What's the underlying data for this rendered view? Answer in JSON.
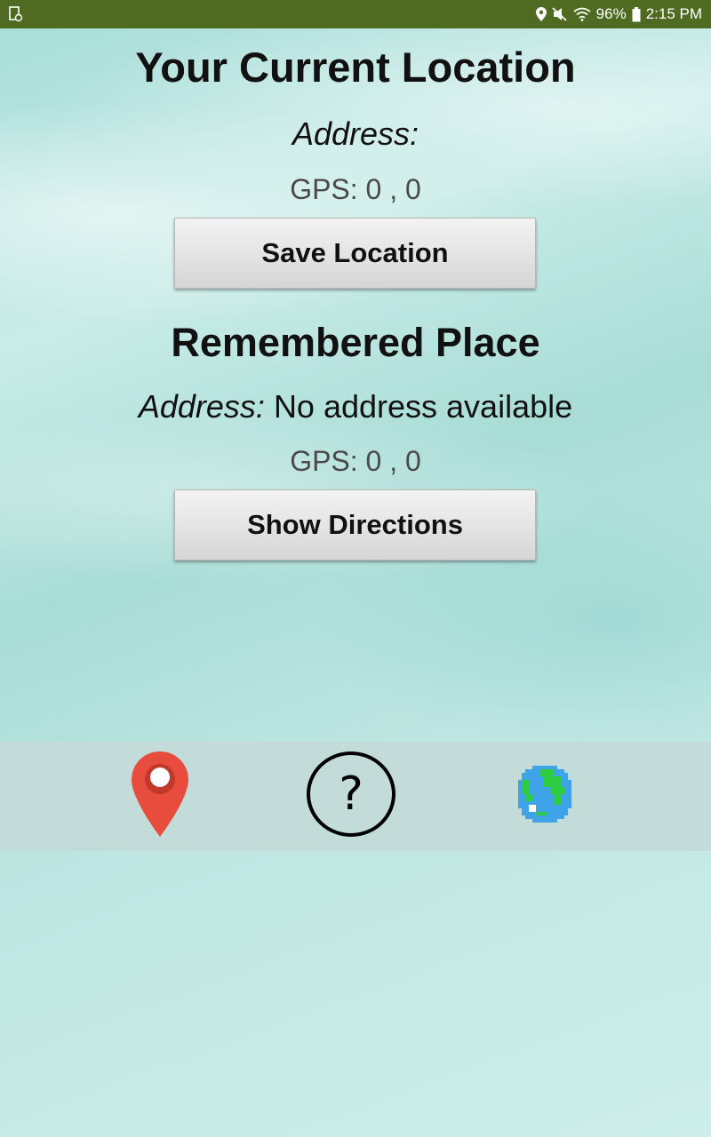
{
  "status_bar": {
    "battery": "96%",
    "time": "2:15 PM"
  },
  "current_location": {
    "title": "Your Current Location",
    "address_label": "Address:",
    "address_value": "",
    "gps": "GPS: 0 , 0",
    "save_button": "Save Location"
  },
  "remembered_place": {
    "title": "Remembered Place",
    "address_label": "Address:",
    "address_value": "No address available",
    "gps": "GPS: 0 , 0",
    "directions_button": "Show Directions"
  },
  "bottom_tabs": [
    {
      "icon": "map-pin-icon",
      "color": "#e74c3c"
    },
    {
      "icon": "help-icon",
      "glyph": "?"
    },
    {
      "icon": "globe-icon",
      "color": "#3fa3e8"
    }
  ],
  "colors": {
    "status_bar": "#4f6b22",
    "tab_bar": "#c3dbd9",
    "pin": "#e74c3c"
  }
}
